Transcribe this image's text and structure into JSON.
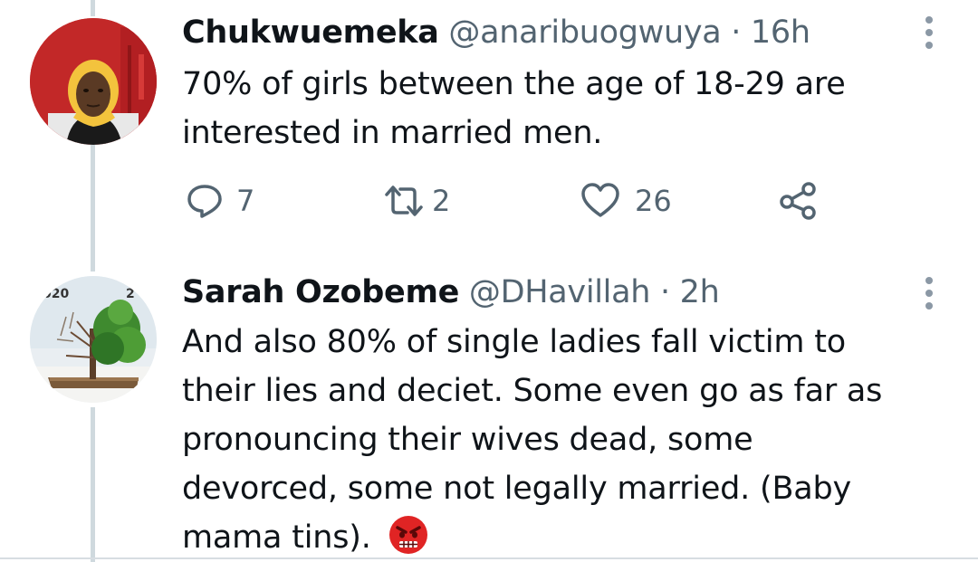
{
  "tweets": [
    {
      "name": "Chukwuemeka",
      "handle": "@anaribuogwuya",
      "separator": "·",
      "time": "16h",
      "body_lines": [
        "70% of girls between the age of 18-29 are",
        "interested in married men."
      ],
      "replies": "7",
      "retweets": "2",
      "likes": "26",
      "avatar_icon": "person-avatar-icon"
    },
    {
      "name": "Sarah Ozobeme",
      "handle": "@DHavillah",
      "separator": "·",
      "time": "2h",
      "body_lines": [
        "And also 80% of single ladies fall victim to",
        "their lies and deciet. Some even go as far as",
        "pronouncing their wives dead, some",
        "devorced, some not legally married. (Baby",
        "mama tins)."
      ],
      "emoji": "angry-face-icon",
      "avatar_icon": "tree-avatar-icon",
      "avatar_text_left": "020",
      "avatar_text_right": "2"
    }
  ],
  "colors": {
    "primary_text": "#0f1419",
    "secondary_text": "#536471",
    "thread_line": "#cfd9de",
    "angry_red": "#e02424"
  }
}
